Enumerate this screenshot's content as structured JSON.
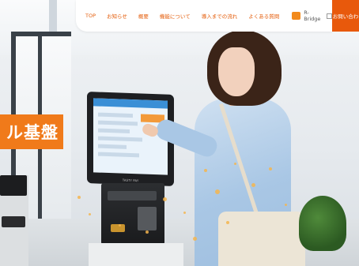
{
  "nav": {
    "items": [
      {
        "label": "TOP"
      },
      {
        "label": "お知らせ"
      },
      {
        "label": "概要"
      },
      {
        "label": "機能について"
      },
      {
        "label": "導入までの流れ"
      },
      {
        "label": "よくある質問"
      }
    ],
    "brand": "R-Bridge",
    "contact_button": "お問い合わ"
  },
  "hero": {
    "banner_text": "ル基盤",
    "kiosk_label": "TASTY PAY"
  },
  "colors": {
    "accent": "#e8590c",
    "banner": "#f07a1a",
    "nav_text": "#e45d0b"
  },
  "icons": {
    "brand_logo": "r-bridge-logo-icon",
    "external_link": "external-link-icon"
  }
}
